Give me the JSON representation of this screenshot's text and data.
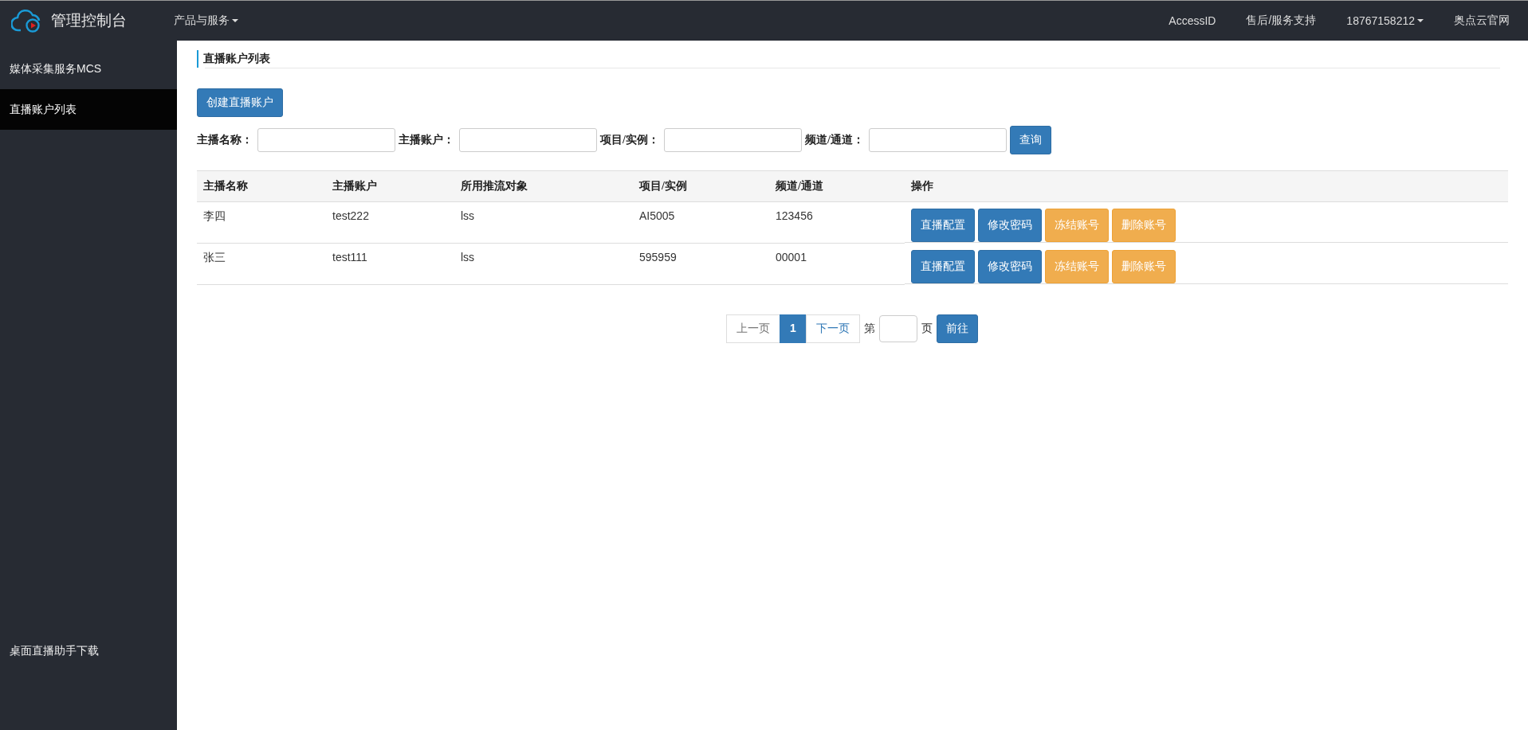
{
  "topbar": {
    "brand": "管理控制台",
    "menu": [
      {
        "label": "产品与服务",
        "dropdown": true
      }
    ],
    "right_links": [
      {
        "label": "AccessID",
        "dropdown": false
      },
      {
        "label": "售后/服务支持",
        "dropdown": false
      },
      {
        "label": "18767158212",
        "dropdown": true
      },
      {
        "label": "奥点云官网",
        "dropdown": false
      }
    ]
  },
  "sidebar": {
    "items": [
      {
        "label": "媒体采集服务MCS",
        "selected": false
      },
      {
        "label": "直播账户列表",
        "selected": true
      }
    ],
    "footer_link": "桌面直播助手下载"
  },
  "page_title": "直播账户列表",
  "create_button": "创建直播账户",
  "filters": [
    {
      "label": "主播名称："
    },
    {
      "label": "主播账户："
    },
    {
      "label": "项目/实例："
    },
    {
      "label": "频道/通道："
    }
  ],
  "search_button": "查询",
  "table": {
    "columns": [
      "主播名称",
      "主播账户",
      "所用推流对象",
      "项目/实例",
      "频道/通道",
      "操作"
    ],
    "rows": [
      {
        "cells": [
          "李四",
          "test222",
          "lss",
          "AI5005",
          "123456"
        ],
        "actions": [
          {
            "label": "直播配置",
            "kind": "primary"
          },
          {
            "label": "修改密码",
            "kind": "primary"
          },
          {
            "label": "冻结账号",
            "kind": "warning"
          },
          {
            "label": "删除账号",
            "kind": "warning"
          }
        ]
      },
      {
        "cells": [
          "张三",
          "test111",
          "lss",
          "595959",
          "00001"
        ],
        "actions": [
          {
            "label": "直播配置",
            "kind": "primary"
          },
          {
            "label": "修改密码",
            "kind": "primary"
          },
          {
            "label": "冻结账号",
            "kind": "warning"
          },
          {
            "label": "删除账号",
            "kind": "warning"
          }
        ]
      }
    ]
  },
  "pagination": {
    "prev": {
      "label": "上一页",
      "disabled": true
    },
    "pages": [
      {
        "label": "1",
        "selected": true
      }
    ],
    "next": {
      "label": "下一页",
      "disabled": false
    },
    "goto_prefix": "第",
    "goto_suffix": "页",
    "goto_button": "前往"
  }
}
